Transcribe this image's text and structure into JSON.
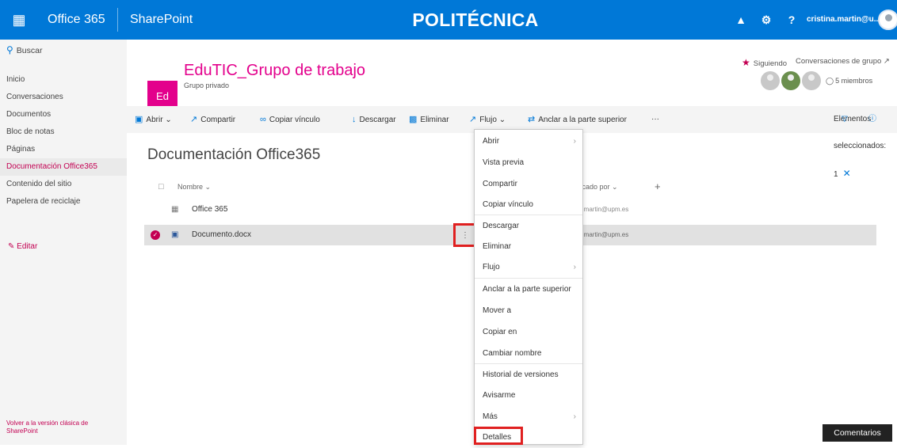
{
  "topbar": {
    "app_name": "Office 365",
    "product": "SharePoint",
    "brand": "POLITÉCNICA",
    "user": "cristina.martin@u...",
    "bg_color": "#0078d7"
  },
  "leftnav": {
    "search_label": "Buscar",
    "items": [
      {
        "label": "Inicio"
      },
      {
        "label": "Conversaciones"
      },
      {
        "label": "Documentos"
      },
      {
        "label": "Bloc de notas"
      },
      {
        "label": "Páginas"
      },
      {
        "label": "Documentación Office365"
      },
      {
        "label": "Contenido del sitio"
      },
      {
        "label": "Papelera de reciclaje"
      }
    ],
    "edit_label": "Editar",
    "classic_link": "Volver a la versión clásica de SharePoint"
  },
  "site": {
    "logo_text": "Ed",
    "title": "EduTIC_Grupo de trabajo",
    "subtitle": "Grupo privado",
    "follow_label": "Siguiendo",
    "conversations_label": "Conversaciones de grupo",
    "members_label": "5 miembros",
    "accent_color": "#e3008c"
  },
  "commandbar": {
    "open": "Abrir",
    "share": "Compartir",
    "copy_link": "Copiar vínculo",
    "download": "Descargar",
    "delete": "Eliminar",
    "flow": "Flujo",
    "pin": "Anclar a la parte superior",
    "more": "···",
    "selected": "Elementos seleccionados: 1"
  },
  "library": {
    "title": "Documentación Office365",
    "columns": {
      "name": "Nombre",
      "modified_by": "ficado por"
    },
    "rows": [
      {
        "name": "Office 365",
        "modified_by": "a.martin@upm.es",
        "selected": false
      },
      {
        "name": "Documento.docx",
        "modified_by": "a.martin@upm.es",
        "selected": true
      }
    ]
  },
  "context_menu": {
    "items": [
      "Abrir",
      "Vista previa",
      "Compartir",
      "Copiar vínculo",
      "Descargar",
      "Eliminar",
      "Flujo",
      "Anclar a la parte superior",
      "Mover a",
      "Copiar en",
      "Cambiar nombre",
      "Historial de versiones",
      "Avisarme",
      "Más",
      "Detalles"
    ]
  },
  "feedback_button": "Comentarios"
}
